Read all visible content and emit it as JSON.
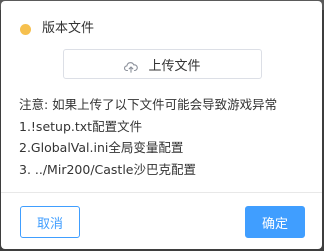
{
  "dialog": {
    "title": "版本文件",
    "status_color": "#f6c04e",
    "upload_button": {
      "label": "上传文件",
      "icon": "cloud-upload-icon"
    },
    "notice": {
      "heading": "注意: 如果上传了以下文件可能会导致游戏异常",
      "items": [
        "1.!setup.txt配置文件",
        "2.GlobalVal.ini全局变量配置",
        "3. ../Mir200/Castle沙巴克配置"
      ]
    },
    "footer": {
      "cancel_label": "取消",
      "confirm_label": "确定"
    },
    "accent_color": "#409eff"
  }
}
